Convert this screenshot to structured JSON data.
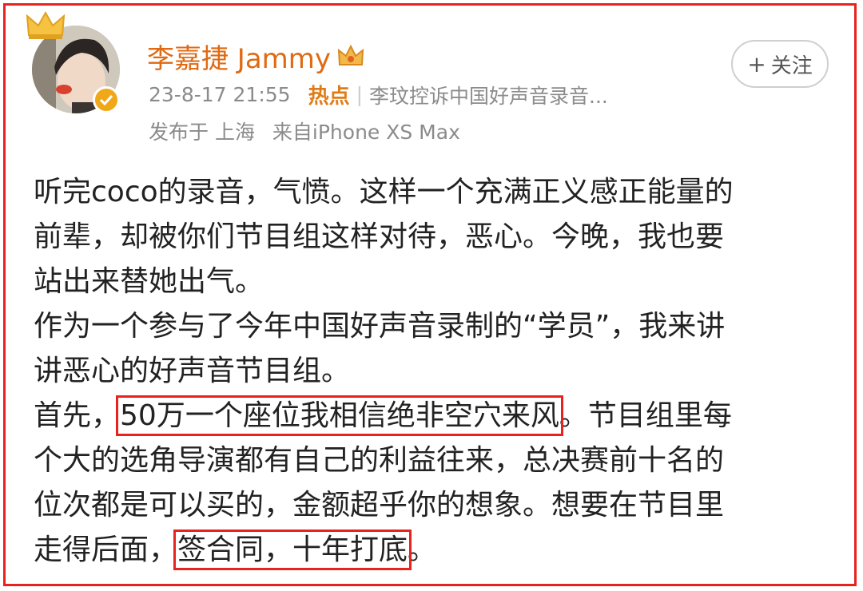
{
  "user": {
    "name": "李嘉捷 Jammy",
    "verified": true
  },
  "meta": {
    "timestamp": "23-8-17 21:55",
    "hot_label": "热点",
    "topic": "李玟控诉中国好声音录音...",
    "location": "发布于 上海",
    "device": "来自iPhone XS Max"
  },
  "follow": {
    "label": "关注",
    "plus": "+"
  },
  "post": {
    "line1": "听完coco的录音，气愤。这样一个充满正义感正能量的",
    "line2": "前辈，却被你们节目组这样对待，恶心。今晚，我也要",
    "line3": "站出来替她出气。",
    "line4": "作为一个参与了今年中国好声音录制的“学员”，我来讲",
    "line5": "讲恶心的好声音节目组。",
    "line6_a": "首先，",
    "line6_hl": "50万一个座位我相信绝非空穴来风",
    "line6_b": "。节目组里每",
    "line7": "个大的选角导演都有自己的利益往来，总决赛前十名的",
    "line8": "位次都是可以买的，金额超乎你的想象。想要在节目里",
    "line9_a": "走得后面，",
    "line9_hl": "签合同，十年打底",
    "line9_b": "。"
  },
  "colors": {
    "frame": "#e8231f",
    "username": "#e06a12",
    "hot": "#e07c16",
    "meta": "#8b8b8b",
    "verified_badge": "#f0a818"
  },
  "icons": {
    "crown": "crown-icon",
    "verified": "verified-badge-icon",
    "vip": "vip-crown-icon"
  }
}
